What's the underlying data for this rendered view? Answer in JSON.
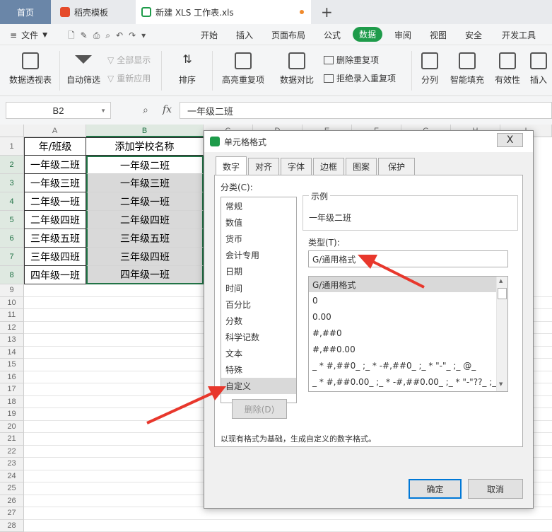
{
  "tabs": {
    "home": "首页",
    "doc": "稻壳模板",
    "xls": "新建 XLS 工作表.xls",
    "plus": "+"
  },
  "menu": {
    "file": "文件",
    "items": [
      "开始",
      "插入",
      "页面布局",
      "公式",
      "数据",
      "审阅",
      "视图",
      "安全",
      "开发工具"
    ],
    "active": "数据"
  },
  "toolbar": {
    "pivot": "数据透视表",
    "autofilter": "自动筛选",
    "show_all": "全部显示",
    "reapply": "重新应用",
    "sort": "排序",
    "highlight_dup": "高亮重复项",
    "compare": "数据对比",
    "remove_dup": "删除重复项",
    "reject_dup": "拒绝录入重复项",
    "split": "分列",
    "smart_fill": "智能填充",
    "validity": "有效性",
    "insert": "插入"
  },
  "formula_bar": {
    "name_box": "B2",
    "fx": "fx",
    "content": "一年级二班"
  },
  "sheet": {
    "columns": [
      "A",
      "B",
      "C",
      "D",
      "E",
      "F",
      "G",
      "H",
      "I"
    ],
    "rows": [
      "1",
      "2",
      "3",
      "4",
      "5",
      "6",
      "7",
      "8",
      "9",
      "10",
      "11",
      "12",
      "13",
      "14",
      "15",
      "16",
      "17",
      "18",
      "19",
      "20",
      "21",
      "22",
      "23",
      "24",
      "25",
      "26",
      "27",
      "28"
    ],
    "col_a": [
      "年/班级",
      "一年级二班",
      "一年级三班",
      "二年级一班",
      "二年级四班",
      "三年级五班",
      "三年级四班",
      "四年级一班"
    ],
    "col_b": [
      "添加学校名称",
      "一年级二班",
      "一年级三班",
      "二年级一班",
      "二年级四班",
      "三年级五班",
      "三年级四班",
      "四年级一班"
    ]
  },
  "dialog": {
    "title": "单元格格式",
    "close": "X",
    "tabs": [
      "数字",
      "对齐",
      "字体",
      "边框",
      "图案",
      "保护"
    ],
    "category_label": "分类(C):",
    "categories": [
      "常规",
      "数值",
      "货币",
      "会计专用",
      "日期",
      "时间",
      "百分比",
      "分数",
      "科学记数",
      "文本",
      "特殊",
      "自定义"
    ],
    "sample_label": "示例",
    "sample_value": "一年级二班",
    "type_label": "类型(T):",
    "type_value": "G/通用格式",
    "type_list": [
      "G/通用格式",
      "0",
      "0.00",
      "#,##0",
      "#,##0.00",
      "_ * #,##0_ ;_ * -#,##0_ ;_ * \"-\"_ ;_ @_",
      "_ * #,##0.00_ ;_ * -#,##0.00_ ;_ * \"-\"??_ ;_ @_"
    ],
    "delete": "删除(D)",
    "description": "以现有格式为基础，生成自定义的数字格式。",
    "ok": "确定",
    "cancel": "取消"
  },
  "colors": {
    "accent": "#1e9b4a",
    "selection_border": "#217346",
    "arrow": "#e8372c"
  }
}
